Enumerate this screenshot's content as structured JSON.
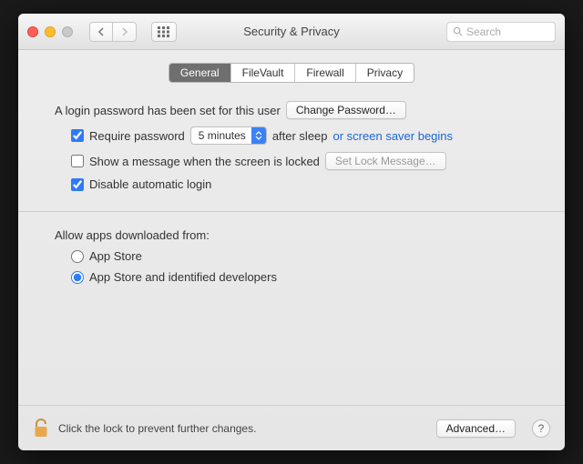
{
  "window": {
    "title": "Security & Privacy"
  },
  "search": {
    "placeholder": "Search"
  },
  "tabs": {
    "general": "General",
    "filevault": "FileVault",
    "firewall": "Firewall",
    "privacy": "Privacy"
  },
  "login": {
    "status_text": "A login password has been set for this user",
    "change_btn": "Change Password…",
    "require_label": "Require password",
    "delay_value": "5 minutes",
    "after_text": "after sleep ",
    "after_link": "or screen saver begins",
    "show_msg_label": "Show a message when the screen is locked",
    "set_lock_btn": "Set Lock Message…",
    "disable_auto_label": "Disable automatic login",
    "require_checked": true,
    "show_msg_checked": false,
    "disable_auto_checked": true
  },
  "gatekeeper": {
    "title": "Allow apps downloaded from:",
    "opt_store": "App Store",
    "opt_identified": "App Store and identified developers",
    "selected": "identified"
  },
  "footer": {
    "lock_text": "Click the lock to prevent further changes.",
    "advanced": "Advanced…"
  }
}
